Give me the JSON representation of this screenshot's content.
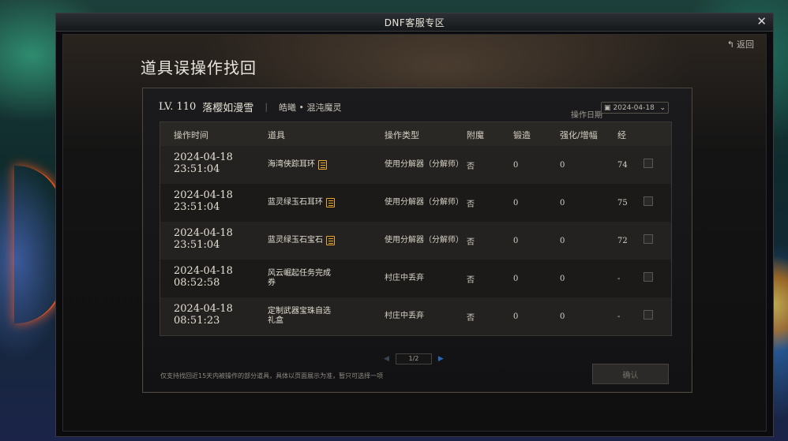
{
  "window": {
    "title": "DNF客服专区",
    "close_label": "✕"
  },
  "header": {
    "return_label": "返回",
    "page_title": "道具误操作找回"
  },
  "character": {
    "level": "LV. 110",
    "name": "落樱如漫雪",
    "separator": "|",
    "server": "皓曦 • 混沌魔灵"
  },
  "date_filter": {
    "label": "操作日期",
    "value": "2024-04-18"
  },
  "table": {
    "columns": [
      "操作时间",
      "道具",
      "操作类型",
      "附魔",
      "锻造",
      "强化/增幅",
      "经"
    ],
    "rows": [
      {
        "date": "2024-04-18",
        "time": "23:51:04",
        "item": "海湾侠踪耳环",
        "has_doc": true,
        "op": "使用分解器（分解师）",
        "enchant": "否",
        "forge": "0",
        "reinforce": "0",
        "exp": "74"
      },
      {
        "date": "2024-04-18",
        "time": "23:51:04",
        "item": "蓝灵绿玉石耳环",
        "has_doc": true,
        "op": "使用分解器（分解师）",
        "enchant": "否",
        "forge": "0",
        "reinforce": "0",
        "exp": "75"
      },
      {
        "date": "2024-04-18",
        "time": "23:51:04",
        "item": "蓝灵绿玉石宝石",
        "has_doc": true,
        "op": "使用分解器（分解师）",
        "enchant": "否",
        "forge": "0",
        "reinforce": "0",
        "exp": "72"
      },
      {
        "date": "2024-04-18",
        "time": "08:52:58",
        "item": "风云崛起任务完成券",
        "has_doc": false,
        "op": "村庄中丢弃",
        "enchant": "否",
        "forge": "0",
        "reinforce": "0",
        "exp": "-"
      },
      {
        "date": "2024-04-18",
        "time": "08:51:23",
        "item": "定制武器宝珠自选礼盒",
        "has_doc": false,
        "op": "村庄中丢弃",
        "enchant": "否",
        "forge": "0",
        "reinforce": "0",
        "exp": "-"
      }
    ]
  },
  "pagination": {
    "page": "1/2"
  },
  "footer": {
    "notice": "仅支持找回近15天内被操作的部分道具，具体以页面展示为准，暂只可选择一项",
    "confirm_label": "确认"
  },
  "icons": {
    "close": "close-icon",
    "return": "return-arrow-icon",
    "calendar": "calendar-icon",
    "chevron": "chevron-down-icon",
    "doc": "document-list-icon"
  },
  "colors": {
    "accent_gold": "#e7a72e",
    "pager_active": "#2b66b6",
    "panel_border": "#4a4741"
  }
}
